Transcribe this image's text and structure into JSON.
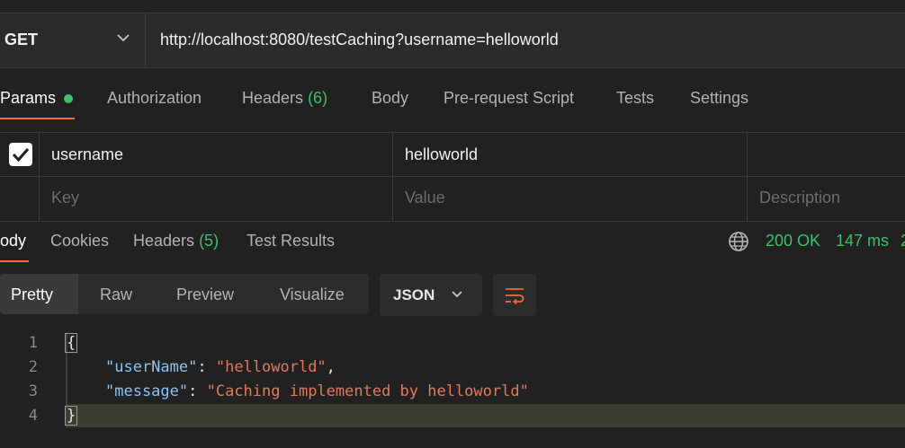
{
  "request": {
    "method": "GET",
    "url": "http://localhost:8080/testCaching?username=helloworld"
  },
  "request_tabs": {
    "params": "Params",
    "authorization": "Authorization",
    "headers": "Headers",
    "headers_count": "(6)",
    "body": "Body",
    "prerequest": "Pre-request Script",
    "tests": "Tests",
    "settings": "Settings"
  },
  "params": {
    "rows": [
      {
        "checked": true,
        "key": "username",
        "value": "helloworld",
        "description": ""
      }
    ],
    "placeholder": {
      "key": "Key",
      "value": "Value",
      "description": "Description"
    }
  },
  "response_tabs": {
    "body": "ody",
    "cookies": "Cookies",
    "headers": "Headers",
    "headers_count": "(5)",
    "test_results": "Test Results"
  },
  "response_status": {
    "status": "200 OK",
    "time": "147 ms",
    "size": "2"
  },
  "format_toolbar": {
    "pretty": "Pretty",
    "raw": "Raw",
    "preview": "Preview",
    "visualize": "Visualize",
    "language": "JSON"
  },
  "code": {
    "line_numbers": [
      "1",
      "2",
      "3",
      "4"
    ],
    "open_brace": "{",
    "close_brace": "}",
    "line2_key": "\"userName\"",
    "line2_value": "\"helloworld\"",
    "line3_key": "\"message\"",
    "line3_value": "\"Caching implemented by helloworld\""
  },
  "colors": {
    "accent": "#f26b3a",
    "success": "#3fbf6e",
    "json_key": "#8fc2f0",
    "json_string": "#e07a5f"
  }
}
